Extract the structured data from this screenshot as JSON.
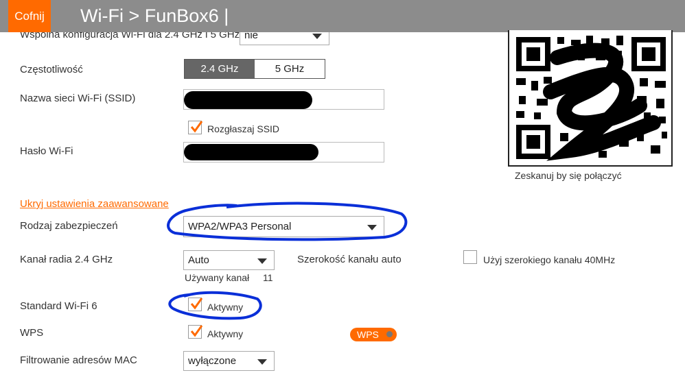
{
  "header": {
    "back_label": "Cofnij",
    "title": "Wi-Fi > FunBox6 |"
  },
  "shared_config": {
    "label": "Wspólna konfiguracja Wi-Fi dla 2.4 GHz i 5 GHz",
    "value": "nie"
  },
  "frequency": {
    "label": "Częstotliwość",
    "options": [
      "2.4 GHz",
      "5 GHz"
    ],
    "selected": "2.4 GHz"
  },
  "ssid": {
    "label": "Nazwa sieci Wi-Fi (SSID)",
    "broadcast_label": "Rozgłaszaj SSID",
    "broadcast_checked": true
  },
  "password": {
    "label": "Hasło Wi-Fi"
  },
  "qr": {
    "caption": "Zeskanuj by się połączyć"
  },
  "advanced_link": "Ukryj ustawienia zaawansowane",
  "security": {
    "label": "Rodzaj zabezpieczeń",
    "value": "WPA2/WPA3 Personal"
  },
  "channel": {
    "label": "Kanał radia 2.4 GHz",
    "value": "Auto",
    "used_label": "Używany kanał",
    "used_value": "11",
    "width_label": "Szerokość kanału auto",
    "wide_label": "Użyj szerokiego kanału 40MHz",
    "wide_checked": false
  },
  "wifi6": {
    "label": "Standard Wi-Fi 6",
    "checkbox_label": "Aktywny",
    "checked": true
  },
  "wps": {
    "label": "WPS",
    "checkbox_label": "Aktywny",
    "checked": true,
    "button_label": "WPS"
  },
  "mac_filter": {
    "label": "Filtrowanie adresów MAC",
    "value": "wyłączone"
  },
  "colors": {
    "accent": "#ff6a00",
    "header_bg": "#8c8c8c",
    "annotation": "#0a2fd8"
  }
}
